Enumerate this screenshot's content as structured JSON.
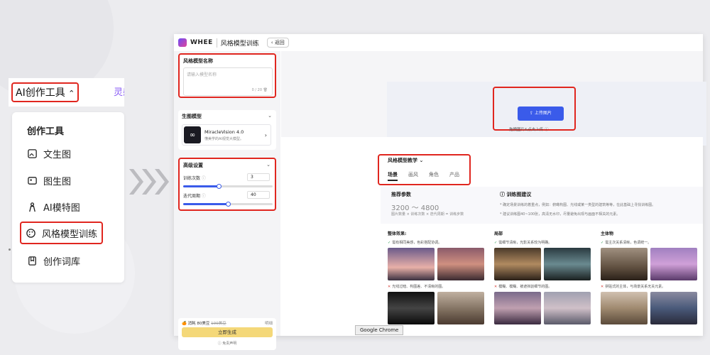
{
  "left_menu": {
    "top_label": "AI创作工具",
    "trailing_text": "灵感",
    "header": "创作工具",
    "items": [
      {
        "icon": "image-text-icon",
        "label": "文生图"
      },
      {
        "icon": "image-image-icon",
        "label": "图生图"
      },
      {
        "icon": "model-figure-icon",
        "label": "AI模特图"
      },
      {
        "icon": "palette-icon",
        "label": "风格模型训练"
      },
      {
        "icon": "book-icon",
        "label": "创作词库"
      }
    ]
  },
  "window": {
    "brand": "WHEE",
    "title": "风格模型训练",
    "back_label": "返回",
    "name_card": {
      "title": "风格模型名称",
      "placeholder": "请输入模型名称",
      "count": "0 / 20"
    },
    "model_card": {
      "title": "生图模型",
      "model_name": "MiracleVision 4.0",
      "model_desc": "懂美学的AI视觉大模型。"
    },
    "advanced": {
      "title": "高级设置",
      "train_label": "训练次数",
      "train_value": "3",
      "train_fraction": 0.4,
      "epoch_label": "迭代周期",
      "epoch_value": "40",
      "epoch_fraction": 0.5
    },
    "cost": {
      "label": "消耗",
      "amount": "80美豆",
      "original": "100美豆",
      "right": "明细"
    },
    "generate_label": "立即生成",
    "disclaimer": "免责声明",
    "upload": {
      "button": "上传图片",
      "tip": "拖拽图片&点击上传"
    },
    "tutorial": {
      "title": "风格模型教学",
      "tabs": [
        "场景",
        "画风",
        "角色",
        "产品"
      ],
      "rec_title": "推荐参数",
      "rec_value": "3200 ～ 4800",
      "rec_formula": "图片数量 × 训练次数 × 迭代周期 = 训练步数",
      "sugg_title": "训练图建议",
      "sugg_1": "* 确定场景训练的着重点，例如：俯瞰构图、光线或某一类型的建筑等等，在此基础上寻找训练图。",
      "sugg_2": "* 建议训练图40~100张，高清无水印，尽量避免出现与画面不相关的元素。",
      "columns": [
        {
          "title": "整体效果",
          "good": "需有相同美感，色彩搭配协调。",
          "bad": "光线过暗、构图差、不清晰的图。"
        },
        {
          "title": "局部",
          "good": "需细节清晰，光影关系较为明确。",
          "bad": "模糊、模糊、被遮挡割细节的图。"
        },
        {
          "title": "主体物",
          "good": "需主次关系清晰，色调统一。",
          "bad": "拼贴式的主体，与场景关系无关元素。"
        }
      ]
    }
  },
  "taskbar": {
    "tooltip": "Google Chrome"
  },
  "colors": {
    "accent": "#3a5bea",
    "highlight": "#e0261f",
    "generate": "#f4d879"
  }
}
